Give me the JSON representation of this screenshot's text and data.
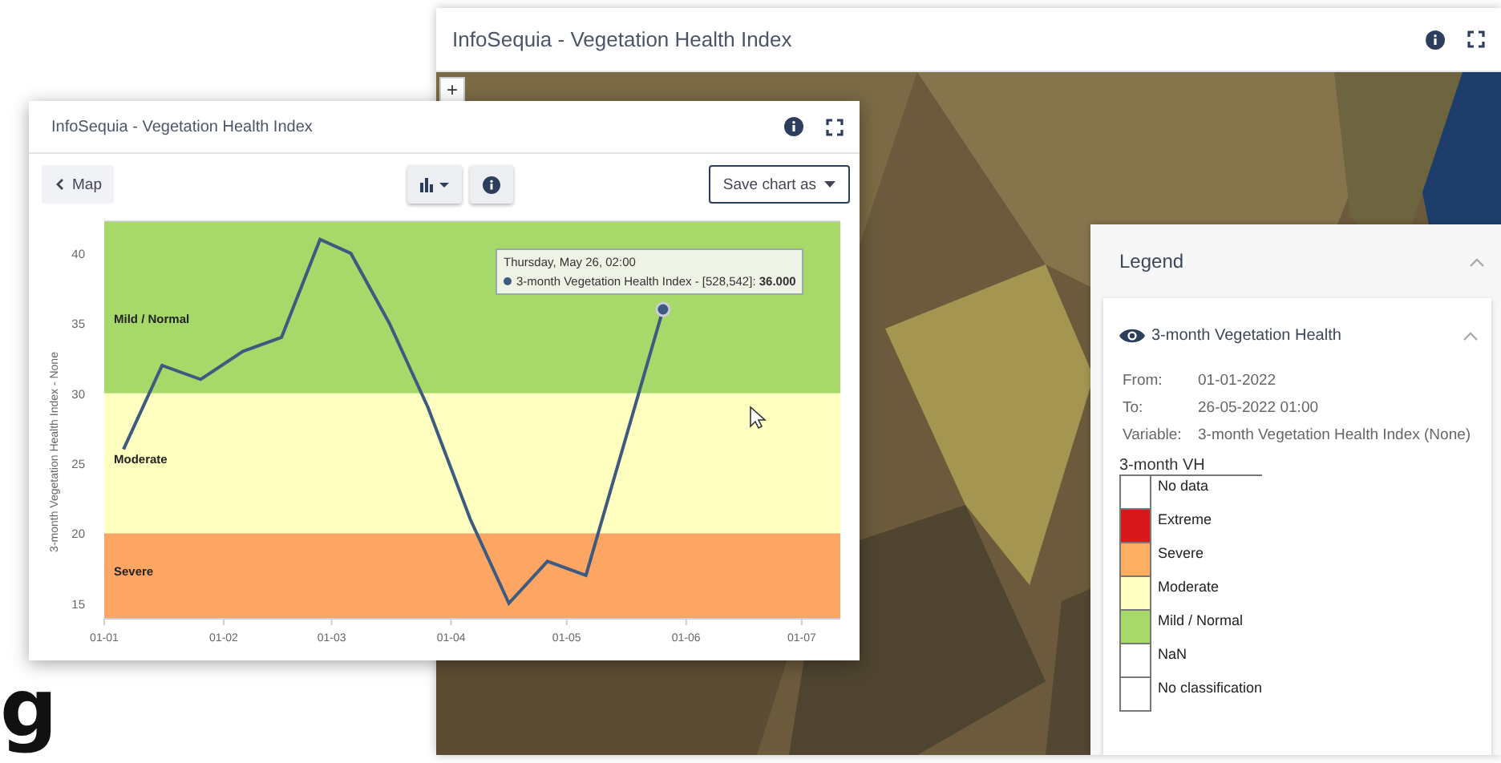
{
  "heading_fragment": "g",
  "map_window": {
    "title": "InfoSequia - Vegetation Health Index",
    "zoom_in": "+",
    "legend": {
      "title": "Legend",
      "expanded": true,
      "layer": {
        "name": "3-month Vegetation Health",
        "visible": true,
        "expanded": true,
        "details": [
          {
            "label": "From:",
            "value": "01-01-2022"
          },
          {
            "label": "To:",
            "value": "26-05-2022 01:00"
          },
          {
            "label": "Variable:",
            "value": "3-month Vegetation Health Index (None)"
          }
        ],
        "scale_title": "3-month VH",
        "classes": [
          {
            "label": "No data",
            "color": "#ffffff"
          },
          {
            "label": "Extreme",
            "color": "#d7191c"
          },
          {
            "label": "Severe",
            "color": "#fdae61"
          },
          {
            "label": "Moderate",
            "color": "#ffffbf"
          },
          {
            "label": "Mild / Normal",
            "color": "#a6d96a"
          },
          {
            "label": "NaN",
            "color": "#ffffff"
          },
          {
            "label": "No classification",
            "color": "#ffffff"
          }
        ]
      }
    }
  },
  "chart_window": {
    "title": "InfoSequia - Vegetation Health Index",
    "back_button": "Map",
    "save_button": "Save chart as",
    "tooltip": {
      "date": "Thursday, May 26, 02:00",
      "separator": ":",
      "value": "36.000"
    },
    "chart_data": {
      "type": "line",
      "ylabel": "3-month Vegetation Health Index - None",
      "x": [
        "2022-01-06",
        "2022-01-16",
        "2022-01-26",
        "2022-02-06",
        "2022-02-16",
        "2022-02-26",
        "2022-03-06",
        "2022-03-16",
        "2022-03-26",
        "2022-04-06",
        "2022-04-16",
        "2022-04-26",
        "2022-05-06",
        "2022-05-26"
      ],
      "series": [
        {
          "name": "3-month Vegetation Health Index - [528,542]",
          "color": "#3d5a80",
          "values": [
            26,
            32,
            31,
            33,
            34,
            41,
            40,
            35,
            29,
            21,
            15,
            18,
            17,
            36
          ]
        }
      ],
      "xlim": [
        "2022-01-01",
        "2022-07-11"
      ],
      "ylim": [
        13.9,
        42.3
      ],
      "xticks": [
        {
          "value": "2022-01-01",
          "label": "01-01"
        },
        {
          "value": "2022-02-01",
          "label": "01-02"
        },
        {
          "value": "2022-03-01",
          "label": "01-03"
        },
        {
          "value": "2022-04-01",
          "label": "01-04"
        },
        {
          "value": "2022-05-01",
          "label": "01-05"
        },
        {
          "value": "2022-06-01",
          "label": "01-06"
        },
        {
          "value": "2022-07-01",
          "label": "01-07"
        }
      ],
      "yticks": [
        15,
        20,
        25,
        30,
        35,
        40
      ],
      "bands": [
        {
          "axis": "y",
          "from": 30,
          "to": 42.3,
          "label": "Mild / Normal",
          "color": "#a6d96a"
        },
        {
          "axis": "y",
          "from": 20,
          "to": 30,
          "label": "Moderate",
          "color": "#ffffbf"
        },
        {
          "axis": "y",
          "from": 13.9,
          "to": 20,
          "label": "Severe",
          "color": "#fda563"
        }
      ]
    }
  }
}
